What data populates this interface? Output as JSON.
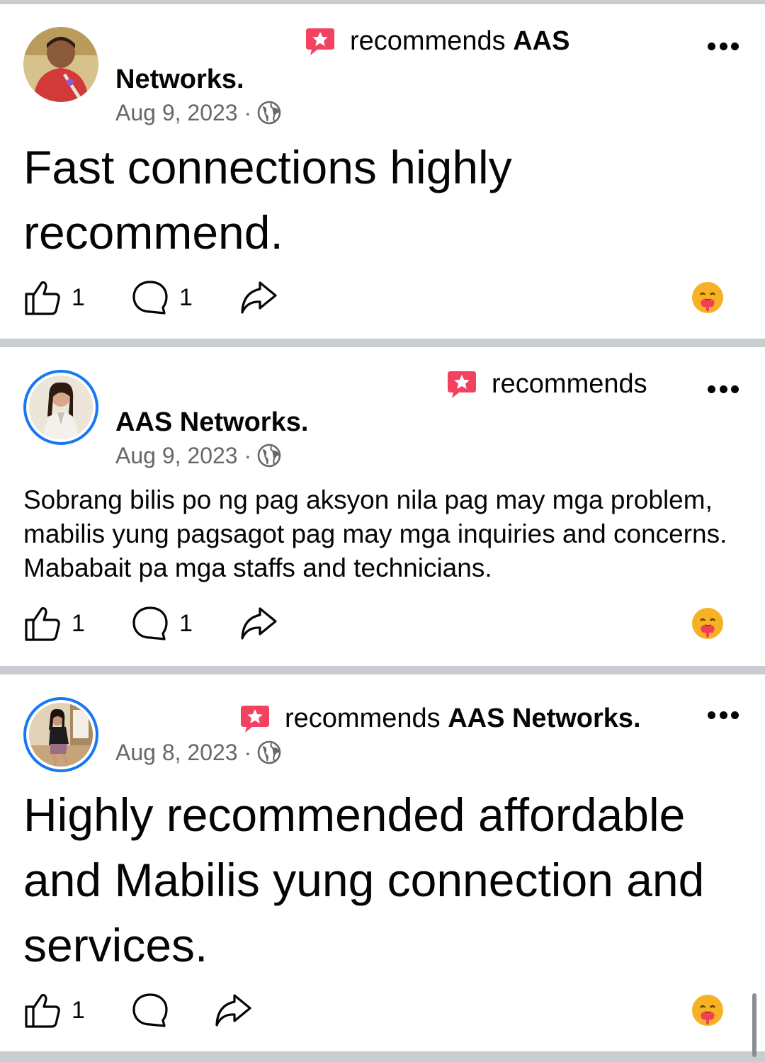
{
  "posts": [
    {
      "verb": "recommends",
      "page_name_inline": "AAS",
      "name_line": "Networks.",
      "date": "Aug 9, 2023",
      "text": "Fast connections highly recommend.",
      "likes": "1",
      "comments": "1"
    },
    {
      "verb": "recommends",
      "name_line": "AAS Networks.",
      "date": "Aug 9, 2023",
      "text": "Sobrang bilis po ng pag aksyon nila pag may mga problem, mabilis yung pagsagot pag may mga inquiries and concerns. Mababait pa mga staffs and technicians.",
      "likes": "1",
      "comments": "1"
    },
    {
      "verb": "recommends",
      "page_name_inline": "AAS Networks.",
      "date": "Aug 8, 2023",
      "text": "Highly recommended affordable and Mabilis yung connection and services.",
      "likes": "1",
      "comments": ""
    }
  ],
  "colors": {
    "separator": "#c9ccd1",
    "secondary_text": "#65676b",
    "story_ring": "#1877f2",
    "recommend_badge": "#f3425f"
  },
  "icons": [
    "recommend-badge-icon",
    "globe-icon",
    "more-icon",
    "like-icon",
    "comment-icon",
    "share-icon",
    "care-reaction-icon"
  ]
}
